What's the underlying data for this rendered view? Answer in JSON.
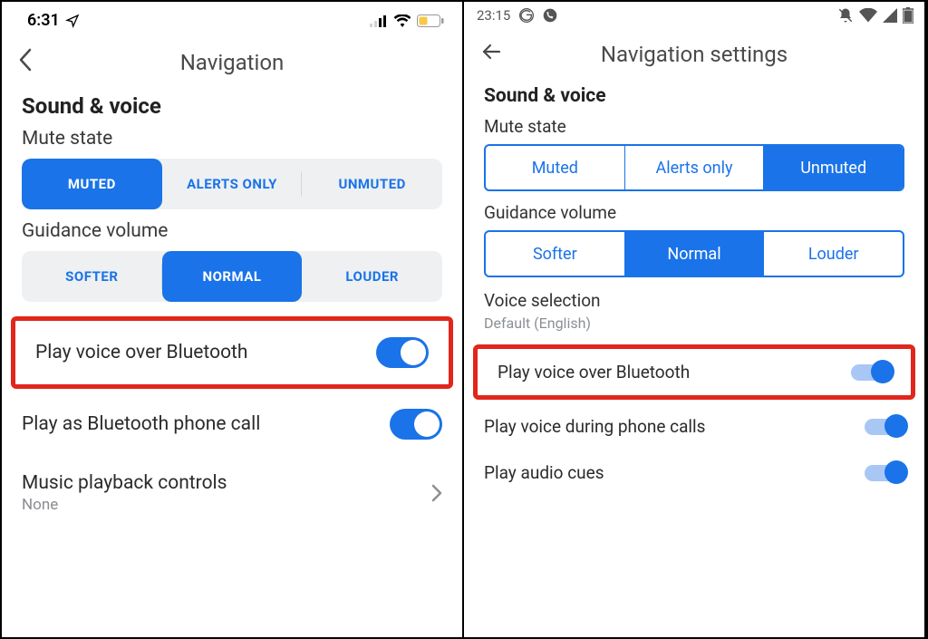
{
  "left": {
    "status": {
      "time": "6:31"
    },
    "title": "Navigation",
    "section_header": "Sound & voice",
    "mute_label": "Mute state",
    "mute_options": {
      "muted": "MUTED",
      "alerts": "ALERTS ONLY",
      "unmuted": "UNMUTED"
    },
    "mute_selected": "muted",
    "guidance_label": "Guidance volume",
    "guidance_options": {
      "softer": "SOFTER",
      "normal": "NORMAL",
      "louder": "LOUDER"
    },
    "guidance_selected": "normal",
    "rows": {
      "bluetooth": "Play voice over Bluetooth",
      "phone_call": "Play as Bluetooth phone call",
      "playback": "Music playback controls",
      "playback_value": "None"
    }
  },
  "right": {
    "status": {
      "time": "23:15"
    },
    "title": "Navigation settings",
    "section_header": "Sound & voice",
    "mute_label": "Mute state",
    "mute_options": {
      "muted": "Muted",
      "alerts": "Alerts only",
      "unmuted": "Unmuted"
    },
    "mute_selected": "unmuted",
    "guidance_label": "Guidance volume",
    "guidance_options": {
      "softer": "Softer",
      "normal": "Normal",
      "louder": "Louder"
    },
    "guidance_selected": "normal",
    "voice_sel_label": "Voice selection",
    "voice_sel_value": "Default (English)",
    "rows": {
      "bluetooth": "Play voice over Bluetooth",
      "during_calls": "Play voice during phone calls",
      "audio_cues": "Play audio cues"
    }
  },
  "colors": {
    "accent": "#1a73e8",
    "highlight": "#e1261c"
  }
}
